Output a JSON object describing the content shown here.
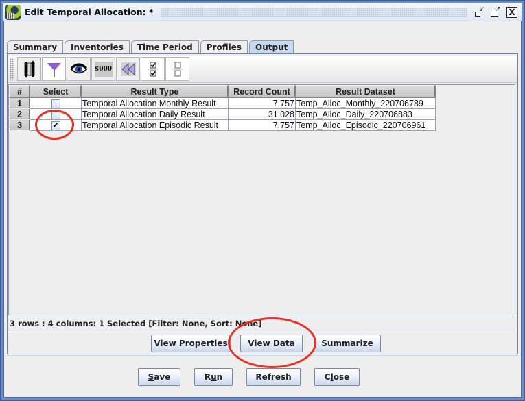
{
  "window": {
    "title": "Edit Temporal Allocation: *",
    "icon": "emf-app-icon",
    "controls": {
      "minimize_icon": "minimize-icon",
      "maximize_icon": "maximize-icon",
      "close_glyph": "X"
    }
  },
  "tabs": [
    {
      "label": "Summary",
      "active": false
    },
    {
      "label": "Inventories",
      "active": false
    },
    {
      "label": "Time Period",
      "active": false
    },
    {
      "label": "Profiles",
      "active": false
    },
    {
      "label": "Output",
      "active": true
    }
  ],
  "toolbar": {
    "buttons": [
      {
        "icon": "sort-columns-icon",
        "tooltip": "Sort"
      },
      {
        "icon": "filter-icon",
        "tooltip": "Filter"
      },
      {
        "icon": "eye-icon",
        "tooltip": "Show/Hide Columns"
      },
      {
        "icon": "format-currency-icon",
        "label": "$000",
        "tooltip": "Format Columns"
      },
      {
        "icon": "reset-icon",
        "tooltip": "Reset"
      },
      {
        "icon": "select-all-icon",
        "tooltip": "Select All"
      },
      {
        "icon": "clear-all-icon",
        "tooltip": "Clear All Selections"
      }
    ]
  },
  "table": {
    "columns": [
      "#",
      "Select",
      "Result Type",
      "Record Count",
      "Result Dataset"
    ],
    "rows": [
      {
        "num": "1",
        "selected": false,
        "result_type": "Temporal Allocation Monthly Result",
        "record_count": "7,757",
        "result_dataset": "Temp_Alloc_Monthly_220706789"
      },
      {
        "num": "2",
        "selected": false,
        "result_type": "Temporal Allocation Daily Result",
        "record_count": "31,028",
        "result_dataset": "Temp_Alloc_Daily_220706883"
      },
      {
        "num": "3",
        "selected": true,
        "result_type": "Temporal Allocation Episodic Result",
        "record_count": "7,757",
        "result_dataset": "Temp_Alloc_Episodic_220706961"
      }
    ]
  },
  "status": "3 rows : 4 columns: 1 Selected [Filter: None, Sort: None]",
  "actions": {
    "view_properties": "View Properties",
    "view_data": "View Data",
    "summarize": "Summarize"
  },
  "footer": {
    "save": {
      "pre": "",
      "mn": "S",
      "post": "ave"
    },
    "run": {
      "pre": "R",
      "mn": "u",
      "post": "n"
    },
    "refresh": "Refresh",
    "close": {
      "pre": "C",
      "mn": "l",
      "post": "ose"
    }
  },
  "colors": {
    "frame": "#6b8cc7",
    "active_tab": "#c5d9ef",
    "annotation": "#ee3124"
  }
}
